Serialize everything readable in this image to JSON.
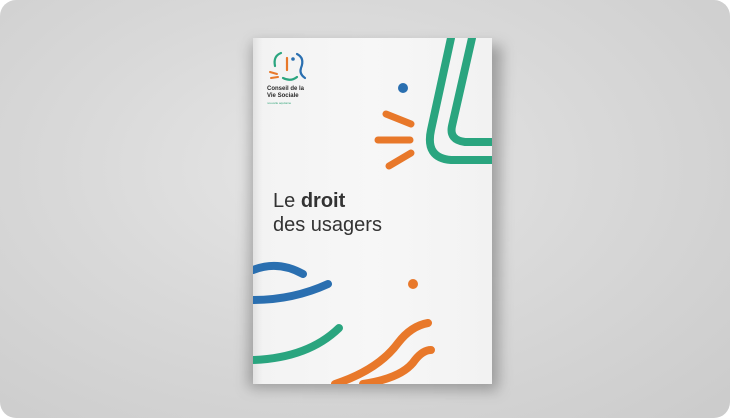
{
  "booklet": {
    "logo": {
      "line1": "Conseil de la",
      "line2": "Vie Sociale",
      "tagline": "nouvelle aquitaine"
    },
    "title": {
      "prefix": "Le ",
      "emphasis": "droit",
      "line2": "des usagers"
    }
  },
  "colors": {
    "green": "#2aa57f",
    "orange": "#e8782a",
    "blue": "#2a6fb0",
    "background": "#d9d9d9",
    "paper": "#f6f6f6"
  },
  "icons": {
    "logo": "face-profile-icon"
  }
}
